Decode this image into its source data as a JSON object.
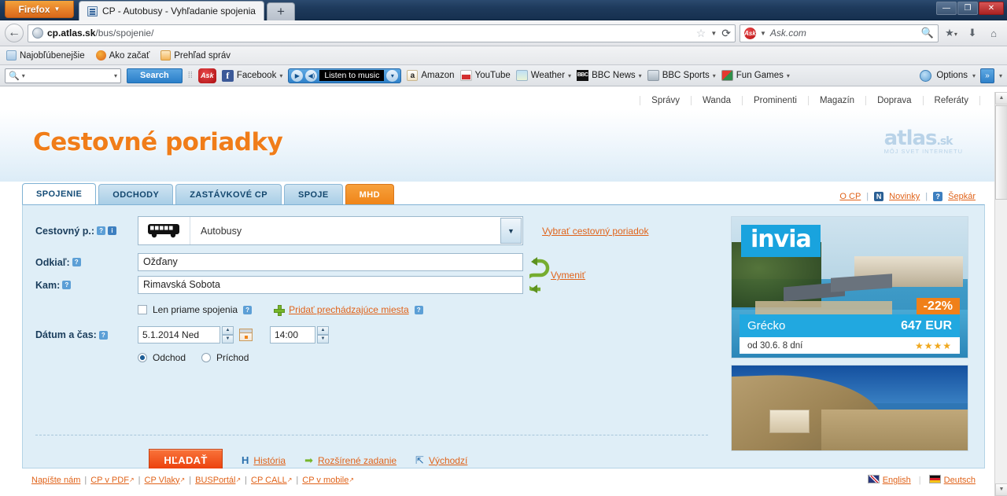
{
  "browser": {
    "firefox_button": "Firefox",
    "tab_title": "CP - Autobusy - Vyhľadanie spojenia",
    "newtab_label": "+",
    "window_buttons": {
      "minimize": "—",
      "maximize": "❐",
      "close": "✕"
    },
    "url": "cp.atlas.sk/bus/spojenie/",
    "url_domain": "cp.atlas.sk",
    "url_path": "/bus/spojenie/",
    "search_engine": "Ask.com",
    "bookmarks": [
      "Najobľúbenejšie",
      "Ako začať",
      "Prehľad správ"
    ],
    "toolbar": {
      "search_placeholder": "",
      "search_button": "Search",
      "facebook": "Facebook",
      "music": "Listen to music",
      "amazon": "Amazon",
      "youtube": "YouTube",
      "weather": "Weather",
      "bbc_news": "BBC News",
      "bbc_sports": "BBC Sports",
      "fun_games": "Fun Games",
      "options": "Options",
      "overflow": "»"
    }
  },
  "page": {
    "topnav": [
      "Správy",
      "Wanda",
      "Prominenti",
      "Magazín",
      "Doprava",
      "Referáty"
    ],
    "logo": "Cestovné poriadky",
    "brand": {
      "name": "atlas",
      "tld": ".sk",
      "tagline": "MÔJ SVET INTERNETU"
    },
    "tabs": [
      {
        "label": "SPOJENIE",
        "state": "active"
      },
      {
        "label": "ODCHODY",
        "state": "normal"
      },
      {
        "label": "ZASTÁVKOVÉ CP",
        "state": "normal"
      },
      {
        "label": "SPOJE",
        "state": "normal"
      },
      {
        "label": "MHD",
        "state": "orange"
      }
    ],
    "helplinks": [
      {
        "label": "O CP",
        "icon": ""
      },
      {
        "label": "Novinky",
        "icon": "N"
      },
      {
        "label": "Šepkár",
        "icon": "?"
      }
    ],
    "form": {
      "carrier_label": "Cestovný p.:",
      "carrier_value": "Autobusy",
      "carrier_link": "Vybrať cestovný poriadok",
      "from_label": "Odkiaľ:",
      "from_value": "Ožďany",
      "to_label": "Kam:",
      "to_value": "Rimavská Sobota",
      "swap_link": "Vymeniť",
      "direct_only": "Len priame spojenia",
      "add_via": "Pridať prechádzajúce miesta",
      "datetime_label": "Dátum a čas:",
      "date_value": "5.1.2014 Ned",
      "time_value": "14:00",
      "radio_departure": "Odchod",
      "radio_arrival": "Príchod",
      "radio_selected": "Odchod",
      "search_button": "HĽADAŤ",
      "history": "História",
      "advanced": "Rozšírené zadanie",
      "defaults": "Východzí",
      "hint_symbol": "?",
      "info_symbol": "i"
    },
    "ad": {
      "brand": "invia",
      "destination": "Grécko",
      "price": "647 EUR",
      "terms": "od 30.6. 8 dní",
      "discount": "-22%",
      "stars": "★★★★"
    },
    "footer": {
      "links": [
        "Napíšte nám",
        "CP v PDF",
        "CP Vlaky",
        "BUSPortál",
        "CP CALL",
        "CP v mobile"
      ],
      "languages": [
        "English",
        "Deutsch"
      ]
    }
  }
}
